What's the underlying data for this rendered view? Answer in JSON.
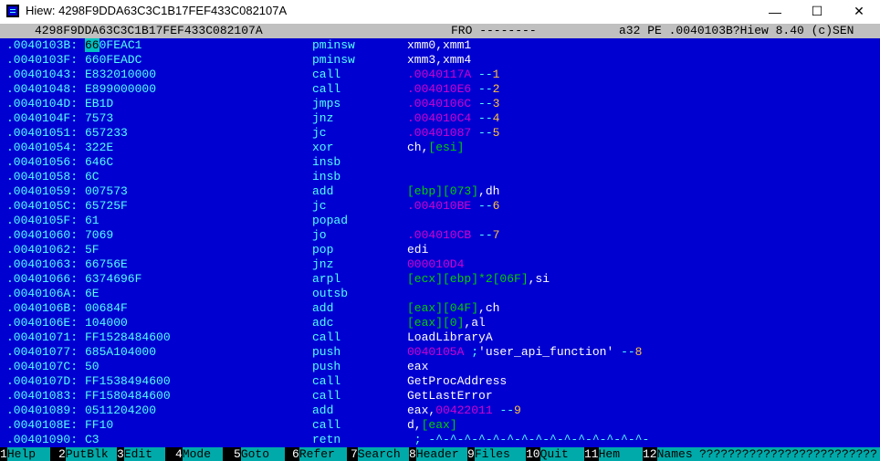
{
  "window": {
    "title": "Hiew: 4298F9DDA63C3C1B17FEF433C082107A",
    "minimize_glyph": "—",
    "maximize_glyph": "☐",
    "close_glyph": "✕"
  },
  "status": {
    "filename": "4298F9DDA63C3C1B17FEF433C082107A",
    "mode": "FRO --------",
    "info": "a32 PE .0040103B?Hiew 8.40 (c)SEN"
  },
  "rows": [
    {
      "addr": ".0040103B:",
      "bytes": "660FEAC1",
      "mnem": "pminsw",
      "ops": [
        {
          "t": "xmm0,xmm1",
          "c": "white"
        }
      ]
    },
    {
      "addr": ".0040103F:",
      "bytes": "660FEADC",
      "mnem": "pminsw",
      "ops": [
        {
          "t": "xmm3,xmm4",
          "c": "white"
        }
      ]
    },
    {
      "addr": ".00401043:",
      "bytes": "E832010000",
      "mnem": "call",
      "ops": [
        {
          "t": ".0040117A",
          "c": "magenta"
        },
        {
          "t": " --",
          "c": "cyan"
        },
        {
          "t": "1",
          "c": "orange"
        }
      ]
    },
    {
      "addr": ".00401048:",
      "bytes": "E899000000",
      "mnem": "call",
      "ops": [
        {
          "t": ".004010E6",
          "c": "magenta"
        },
        {
          "t": " --",
          "c": "cyan"
        },
        {
          "t": "2",
          "c": "orange"
        }
      ]
    },
    {
      "addr": ".0040104D:",
      "bytes": "EB1D",
      "mnem": "jmps",
      "ops": [
        {
          "t": ".0040106C",
          "c": "magenta"
        },
        {
          "t": " --",
          "c": "cyan"
        },
        {
          "t": "3",
          "c": "orange"
        }
      ]
    },
    {
      "addr": ".0040104F:",
      "bytes": "7573",
      "mnem": "jnz",
      "ops": [
        {
          "t": ".004010C4",
          "c": "magenta"
        },
        {
          "t": " --",
          "c": "cyan"
        },
        {
          "t": "4",
          "c": "orange"
        }
      ]
    },
    {
      "addr": ".00401051:",
      "bytes": "657233",
      "mnem": "jc",
      "ops": [
        {
          "t": ".00401087",
          "c": "magenta"
        },
        {
          "t": " --",
          "c": "cyan"
        },
        {
          "t": "5",
          "c": "orange"
        }
      ]
    },
    {
      "addr": ".00401054:",
      "bytes": "322E",
      "mnem": "xor",
      "ops": [
        {
          "t": "ch,",
          "c": "white"
        },
        {
          "t": "[esi]",
          "c": "green"
        }
      ]
    },
    {
      "addr": ".00401056:",
      "bytes": "646C",
      "mnem": "insb",
      "ops": []
    },
    {
      "addr": ".00401058:",
      "bytes": "6C",
      "mnem": "insb",
      "ops": []
    },
    {
      "addr": ".00401059:",
      "bytes": "007573",
      "mnem": "add",
      "ops": [
        {
          "t": "[ebp][073]",
          "c": "green"
        },
        {
          "t": ",dh",
          "c": "white"
        }
      ]
    },
    {
      "addr": ".0040105C:",
      "bytes": "65725F",
      "mnem": "jc",
      "ops": [
        {
          "t": ".004010BE",
          "c": "magenta"
        },
        {
          "t": " --",
          "c": "cyan"
        },
        {
          "t": "6",
          "c": "orange"
        }
      ]
    },
    {
      "addr": ".0040105F:",
      "bytes": "61",
      "mnem": "popad",
      "ops": []
    },
    {
      "addr": ".00401060:",
      "bytes": "7069",
      "mnem": "jo",
      "ops": [
        {
          "t": ".004010CB",
          "c": "magenta"
        },
        {
          "t": " --",
          "c": "cyan"
        },
        {
          "t": "7",
          "c": "orange"
        }
      ]
    },
    {
      "addr": ".00401062:",
      "bytes": "5F",
      "mnem": "pop",
      "ops": [
        {
          "t": "edi",
          "c": "white"
        }
      ]
    },
    {
      "addr": ".00401063:",
      "bytes": "66756E",
      "mnem": "jnz",
      "ops": [
        {
          "t": "000010D4",
          "c": "magenta"
        }
      ]
    },
    {
      "addr": ".00401066:",
      "bytes": "6374696F",
      "mnem": "arpl",
      "ops": [
        {
          "t": "[ecx][ebp]*2[06F]",
          "c": "green"
        },
        {
          "t": ",si",
          "c": "white"
        }
      ]
    },
    {
      "addr": ".0040106A:",
      "bytes": "6E",
      "mnem": "outsb",
      "ops": []
    },
    {
      "addr": ".0040106B:",
      "bytes": "00684F",
      "mnem": "add",
      "ops": [
        {
          "t": "[eax][04F]",
          "c": "green"
        },
        {
          "t": ",ch",
          "c": "white"
        }
      ]
    },
    {
      "addr": ".0040106E:",
      "bytes": "104000",
      "mnem": "adc",
      "ops": [
        {
          "t": "[eax][0]",
          "c": "green"
        },
        {
          "t": ",al",
          "c": "white"
        }
      ]
    },
    {
      "addr": ".00401071:",
      "bytes": "FF1528484600",
      "mnem": "call",
      "ops": [
        {
          "t": "LoadLibraryA",
          "c": "white"
        }
      ]
    },
    {
      "addr": ".00401077:",
      "bytes": "685A104000",
      "mnem": "push",
      "ops": [
        {
          "t": "0040105A",
          "c": "magenta"
        },
        {
          "t": " ;",
          "c": "cyan"
        },
        {
          "t": "'user_api_function'",
          "c": "white"
        },
        {
          "t": " --",
          "c": "cyan"
        },
        {
          "t": "8",
          "c": "orange"
        }
      ]
    },
    {
      "addr": ".0040107C:",
      "bytes": "50",
      "mnem": "push",
      "ops": [
        {
          "t": "eax",
          "c": "white"
        }
      ]
    },
    {
      "addr": ".0040107D:",
      "bytes": "FF1538494600",
      "mnem": "call",
      "ops": [
        {
          "t": "GetProcAddress",
          "c": "white"
        }
      ]
    },
    {
      "addr": ".00401083:",
      "bytes": "FF1580484600",
      "mnem": "call",
      "ops": [
        {
          "t": "GetLastError",
          "c": "white"
        }
      ]
    },
    {
      "addr": ".00401089:",
      "bytes": "0511204200",
      "mnem": "add",
      "ops": [
        {
          "t": "eax,",
          "c": "white"
        },
        {
          "t": "00422011",
          "c": "magenta"
        },
        {
          "t": " --",
          "c": "cyan"
        },
        {
          "t": "9",
          "c": "orange"
        }
      ]
    },
    {
      "addr": ".0040108E:",
      "bytes": "FF10",
      "mnem": "call",
      "ops": [
        {
          "t": "d,",
          "c": "white"
        },
        {
          "t": "[eax]",
          "c": "green"
        }
      ]
    },
    {
      "addr": ".00401090:",
      "bytes": "C3",
      "mnem": "retn",
      "ops": [
        {
          "t": " ; -^-^-^-^-^-^-^-^-^-^-^-^-^-^-^-",
          "c": "cyan"
        }
      ]
    }
  ],
  "fkeys": [
    {
      "num": "1",
      "label": "Help"
    },
    {
      "num": "2",
      "label": "PutBlk"
    },
    {
      "num": "3",
      "label": "Edit"
    },
    {
      "num": "4",
      "label": "Mode"
    },
    {
      "num": "5",
      "label": "Goto"
    },
    {
      "num": "6",
      "label": "Refer"
    },
    {
      "num": "7",
      "label": "Search"
    },
    {
      "num": "8",
      "label": "Header"
    },
    {
      "num": "9",
      "label": "Files"
    },
    {
      "num": "10",
      "label": "Quit"
    },
    {
      "num": "11",
      "label": "Hem"
    },
    {
      "num": "12",
      "label": "Names"
    }
  ],
  "fkeys_tail": "?????????????????????????",
  "colors": {
    "screen_bg": "#0000d0",
    "status_bg": "#c0c0c0",
    "fkey_bg": "#00aaaa"
  }
}
